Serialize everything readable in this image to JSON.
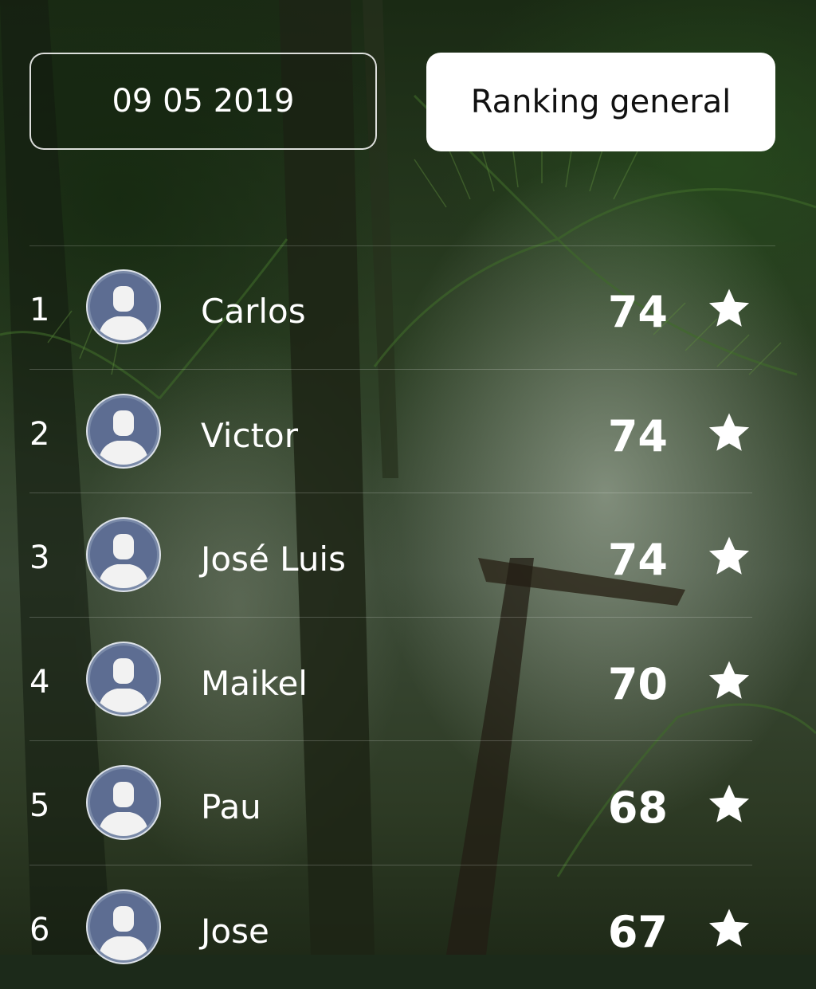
{
  "header": {
    "date_label": "09 05 2019",
    "ranking_label": "Ranking general"
  },
  "colors": {
    "ranking_button_bg": "#ffffff",
    "ranking_button_text": "#111111",
    "avatar_bg": "#5d6d92",
    "text": "#ffffff"
  },
  "ranking": [
    {
      "position": "1",
      "name": "Carlos",
      "score": "74"
    },
    {
      "position": "2",
      "name": "Victor",
      "score": "74"
    },
    {
      "position": "3",
      "name": "José Luis",
      "score": "74"
    },
    {
      "position": "4",
      "name": "Maikel",
      "score": "70"
    },
    {
      "position": "5",
      "name": "Pau",
      "score": "68"
    },
    {
      "position": "6",
      "name": "Jose",
      "score": "67"
    }
  ],
  "icons": {
    "avatar": "user-silhouette-icon",
    "rating": "star-icon"
  }
}
